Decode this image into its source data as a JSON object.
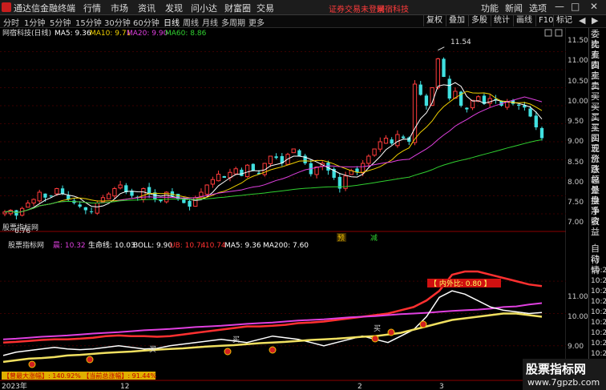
{
  "app": {
    "title": "通达信金融终端",
    "brand_color": "#c81e1e"
  },
  "menu": [
    "行情",
    "市场",
    "资讯",
    "发现",
    "问小达",
    "财富圈",
    "交易"
  ],
  "login_notice": "证券交易未登录",
  "stock_name_header": "网宿科技",
  "right_menu": [
    "功能",
    "新闻",
    "选项"
  ],
  "periods": [
    "分时",
    "1分钟",
    "5分钟",
    "15分钟",
    "30分钟",
    "60分钟",
    "日线",
    "周线",
    "月线",
    "多周期",
    "更多"
  ],
  "active_period": "日线",
  "tools": [
    "复权",
    "叠加",
    "多股",
    "统计",
    "画线",
    "F10",
    "标记"
  ],
  "main_chart": {
    "name": "网宿科技(日线)",
    "ma": [
      {
        "label": "MA5: 9.36",
        "color": "#ffffff"
      },
      {
        "label": "MA10: 9.71",
        "color": "#f0d000"
      },
      {
        "label": "MA20: 9.90",
        "color": "#e040e0"
      },
      {
        "label": "MA60: 8.86",
        "color": "#30d030"
      }
    ],
    "y_ticks": [
      "11.50",
      "11.00",
      "10.50",
      "10.00",
      "9.50",
      "9.00",
      "8.50",
      "8.00",
      "7.50",
      "7.00"
    ],
    "high_label": "11.54",
    "low_label": "6.76",
    "markers": [
      {
        "text": "预",
        "color": "#f0c000"
      },
      {
        "text": "减",
        "color": "#30d030"
      }
    ]
  },
  "sub_chart": {
    "name": "股票指标网",
    "items": [
      {
        "label": "晨: 10.32",
        "color": "#e040e0"
      },
      {
        "label": "生命线: 10.03",
        "color": "#ffffff"
      },
      {
        "label": "BOLL: 9.90",
        "color": "#ffffff"
      },
      {
        "label": "UB: 10.74",
        "color": "#ff3030"
      },
      {
        "label": ": 10.74",
        "color": "#ff3030"
      },
      {
        "label": "MA5: 9.36",
        "color": "#ffffff"
      },
      {
        "label": "MA200: 7.60",
        "color": "#ffffff"
      }
    ],
    "y_ticks": [
      "11.00",
      "10.00",
      "9.00"
    ],
    "inner_ratio": "【 内外比: 0.80 】",
    "bottom_stats": "【曾最大涨幅】: 140.92% 【当前总涨幅】: 91.44%",
    "buy_label": "买"
  },
  "time_axis": [
    "2023年",
    "12",
    "2",
    "3"
  ],
  "right_panel_top": [
    "委比",
    "卖五",
    "卖四",
    "卖三",
    "卖二",
    "卖一",
    "买一",
    "买二",
    "买三",
    "买四",
    "买五",
    "现价",
    "涨跌",
    "涨幅",
    "总量",
    "外盘",
    "换手",
    "净资",
    "收益"
  ],
  "right_panel_bottom": [
    "自动",
    "行情"
  ],
  "time_rows": [
    "10:27",
    "10:27",
    "10:27",
    "10:27",
    "10:27",
    "10:27",
    "10:27",
    "10:27",
    "10:27",
    "10:27"
  ],
  "watermark": {
    "line1": "股票指标网",
    "line2": "www.7gpzb.com"
  },
  "window": {
    "minimize": "—",
    "maximize": "□",
    "close": "✕"
  },
  "chart_data": {
    "type": "line",
    "ylim": [
      6.6,
      11.8
    ],
    "candles_start": "2023年",
    "close": [
      7.05,
      7.1,
      6.95,
      7.15,
      7.3,
      7.4,
      7.6,
      7.45,
      7.5,
      7.7,
      7.55,
      7.4,
      7.3,
      7.2,
      7.1,
      7.05,
      7.3,
      7.45,
      7.55,
      7.7,
      7.8,
      7.6,
      7.5,
      7.45,
      7.7,
      7.55,
      7.4,
      7.35,
      7.6,
      7.5,
      7.4,
      7.3,
      7.2,
      7.45,
      7.6,
      7.8,
      7.95,
      8.1,
      8.0,
      8.15,
      8.25,
      8.05,
      8.35,
      8.2,
      8.1,
      8.4,
      8.6,
      8.55,
      8.4,
      8.65,
      8.8,
      8.6,
      8.4,
      8.1,
      8.3,
      8.4,
      8.2,
      8.0,
      7.7,
      8.05,
      8.2,
      8.15,
      8.4,
      8.6,
      8.8,
      9.0,
      9.1,
      8.95,
      9.2,
      9.1,
      9.0,
      10.6,
      10.3,
      10.0,
      10.5,
      11.3,
      10.8,
      10.2,
      10.4,
      10.0,
      9.9,
      10.15,
      10.25,
      10.05,
      10.2,
      10.15,
      10.0,
      10.1,
      10.05,
      10.0,
      9.95,
      9.7,
      9.4,
      9.1
    ],
    "ma_series": [
      {
        "name": "MA5",
        "color": "#ffffff"
      },
      {
        "name": "MA10",
        "color": "#f0d000"
      },
      {
        "name": "MA20",
        "color": "#e040e0"
      },
      {
        "name": "MA60",
        "color": "#30d030"
      }
    ],
    "sub_series": [
      {
        "name": "UB",
        "color": "#ff3030",
        "values": [
          9.1,
          9.12,
          9.15,
          9.18,
          9.2,
          9.2,
          9.22,
          9.25,
          9.3,
          9.32,
          9.3,
          9.3,
          9.28,
          9.3,
          9.35,
          9.4,
          9.45,
          9.5,
          9.55,
          9.6,
          9.6,
          9.62,
          9.65,
          9.7,
          9.72,
          9.75,
          9.8,
          9.85,
          9.9,
          9.95,
          10.0,
          10.1,
          10.2,
          10.4,
          10.7,
          11.2,
          11.3,
          11.3,
          11.2,
          11.1,
          11.0,
          10.9,
          10.85
        ]
      },
      {
        "name": "晨",
        "color": "#e040e0",
        "values": [
          9.2,
          9.22,
          9.25,
          9.28,
          9.3,
          9.32,
          9.35,
          9.38,
          9.4,
          9.42,
          9.45,
          9.48,
          9.5,
          9.52,
          9.55,
          9.58,
          9.6,
          9.62,
          9.65,
          9.68,
          9.7,
          9.72,
          9.75,
          9.78,
          9.8,
          9.82,
          9.85,
          9.88,
          9.9,
          9.92,
          9.95,
          9.98,
          10.0,
          10.02,
          10.05,
          10.08,
          10.1,
          10.12,
          10.15,
          10.2,
          10.22,
          10.28,
          10.32
        ]
      },
      {
        "name": "生命线",
        "color": "#ffffff",
        "values": [
          8.7,
          8.8,
          8.85,
          8.9,
          8.95,
          8.9,
          8.88,
          8.9,
          8.95,
          9.0,
          8.95,
          8.9,
          8.92,
          9.0,
          9.05,
          9.1,
          9.15,
          9.2,
          9.15,
          9.1,
          9.2,
          9.3,
          9.25,
          9.2,
          9.1,
          9.0,
          9.1,
          9.2,
          9.3,
          9.2,
          9.1,
          9.3,
          9.5,
          9.9,
          10.5,
          10.7,
          10.6,
          10.4,
          10.2,
          10.1,
          10.05,
          10.0,
          10.03
        ]
      },
      {
        "name": "BOLL",
        "color": "#f0e060",
        "values": [
          8.5,
          8.55,
          8.6,
          8.62,
          8.65,
          8.7,
          8.72,
          8.75,
          8.78,
          8.8,
          8.82,
          8.85,
          8.88,
          8.9,
          8.92,
          8.95,
          8.98,
          9.0,
          9.02,
          9.05,
          9.08,
          9.1,
          9.12,
          9.15,
          9.18,
          9.2,
          9.22,
          9.25,
          9.28,
          9.3,
          9.35,
          9.4,
          9.5,
          9.6,
          9.7,
          9.8,
          9.85,
          9.9,
          9.95,
          10.0,
          10.0,
          9.95,
          9.9
        ]
      }
    ],
    "sub_ylim": [
      8.3,
      11.4
    ]
  }
}
